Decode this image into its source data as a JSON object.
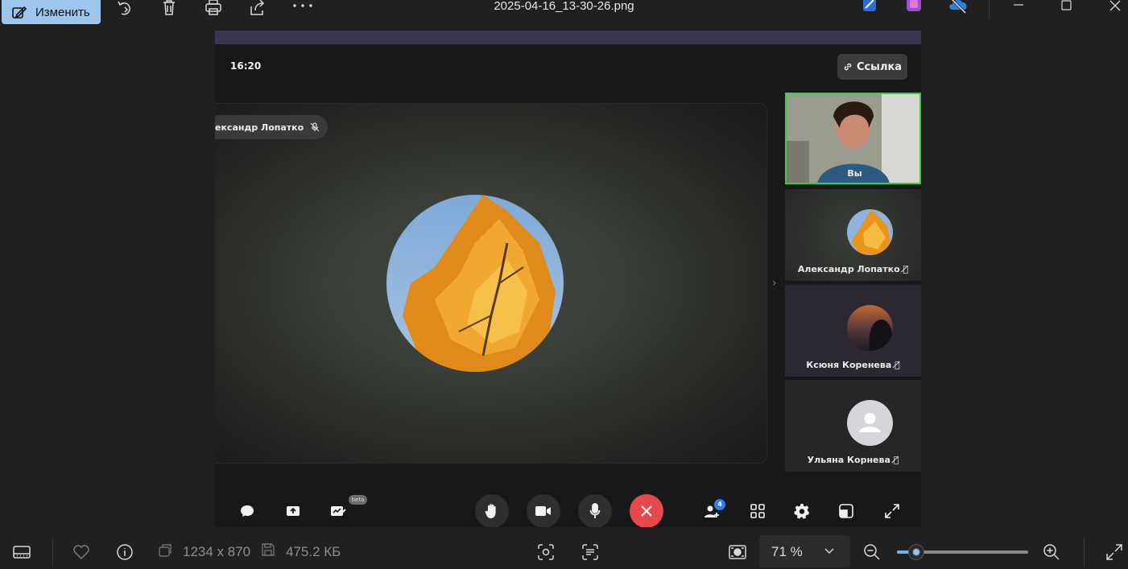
{
  "window": {
    "edit_label": "Изменить",
    "filename": "2025-04-16_13-30-26.png"
  },
  "call": {
    "time": "16:20",
    "link_label": "Ссылка",
    "main_speaker": "ександр Лопатко",
    "participants": [
      {
        "name": "Вы"
      },
      {
        "name": "Александр Лопатко"
      },
      {
        "name": "Ксюня Коренева"
      },
      {
        "name": "Ульяна Корнева"
      }
    ],
    "beta_label": "beta",
    "people_count": "4",
    "accent": "#e5484d"
  },
  "statusbar": {
    "dimensions": "1234 x 870",
    "filesize": "475.2 КБ",
    "zoom": "71 %",
    "zoom_level": 0.15
  }
}
